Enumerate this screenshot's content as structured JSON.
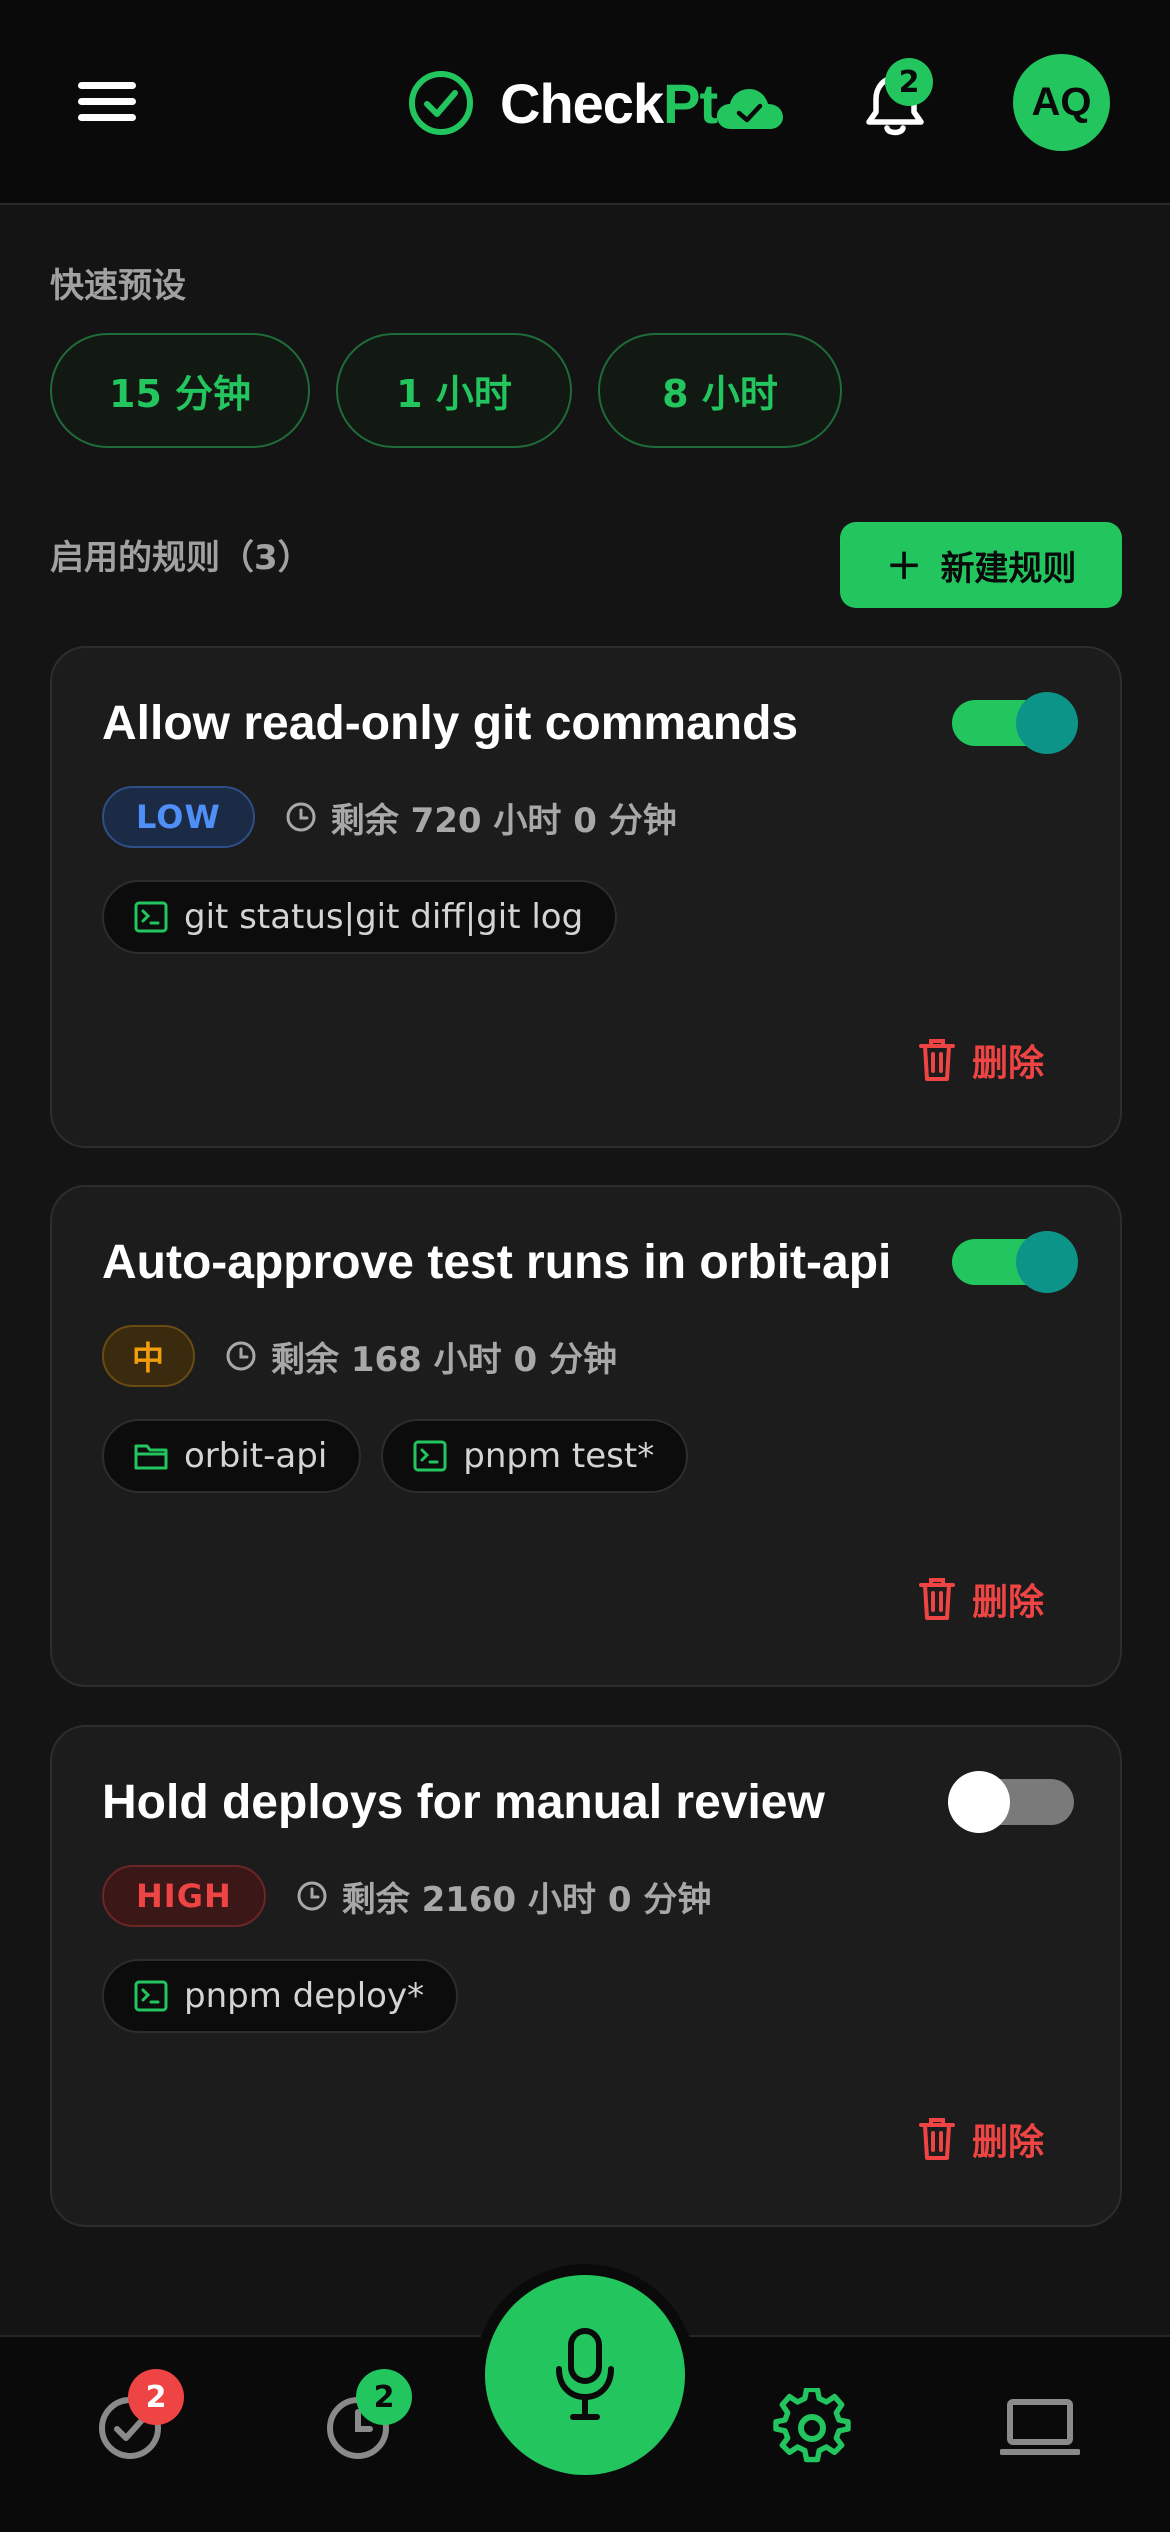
{
  "header": {
    "brand_part1": "Check",
    "brand_part2": "Pt",
    "notification_count": "2",
    "avatar_initials": "AQ"
  },
  "presets": {
    "label": "快速预设",
    "items": [
      "15 分钟",
      "1 小时",
      "8 小时"
    ]
  },
  "rules": {
    "label": "启用的规则（3）",
    "new_rule_label": "新建规则",
    "delete_label": "删除",
    "items": [
      {
        "title": "Allow read-only git commands",
        "enabled": true,
        "risk": "LOW",
        "remaining": "剩余 720 小时 0 分钟",
        "chips": [
          {
            "icon": "terminal-icon",
            "text": "git status|git diff|git log"
          }
        ]
      },
      {
        "title": "Auto-approve test runs in orbit-api",
        "enabled": true,
        "risk": "中",
        "remaining": "剩余 168 小时 0 分钟",
        "chips": [
          {
            "icon": "folder-icon",
            "text": "orbit-api"
          },
          {
            "icon": "terminal-icon",
            "text": "pnpm test*"
          }
        ]
      },
      {
        "title": "Hold deploys for manual review",
        "enabled": false,
        "risk": "HIGH",
        "remaining": "剩余 2160 小时 0 分钟",
        "chips": [
          {
            "icon": "terminal-icon",
            "text": "pnpm deploy*"
          }
        ]
      }
    ]
  },
  "bottom_nav": {
    "approvals_badge": "2",
    "history_badge": "2",
    "items": [
      "approvals-icon",
      "history-icon",
      "microphone-icon",
      "settings-icon",
      "laptop-icon"
    ],
    "active": "settings-icon"
  },
  "colors": {
    "accent": "#22c55e",
    "danger": "#ef4444",
    "warning": "#f59e0b",
    "info": "#4f8ff7",
    "background": "#141414",
    "card": "#1c1c1c"
  }
}
